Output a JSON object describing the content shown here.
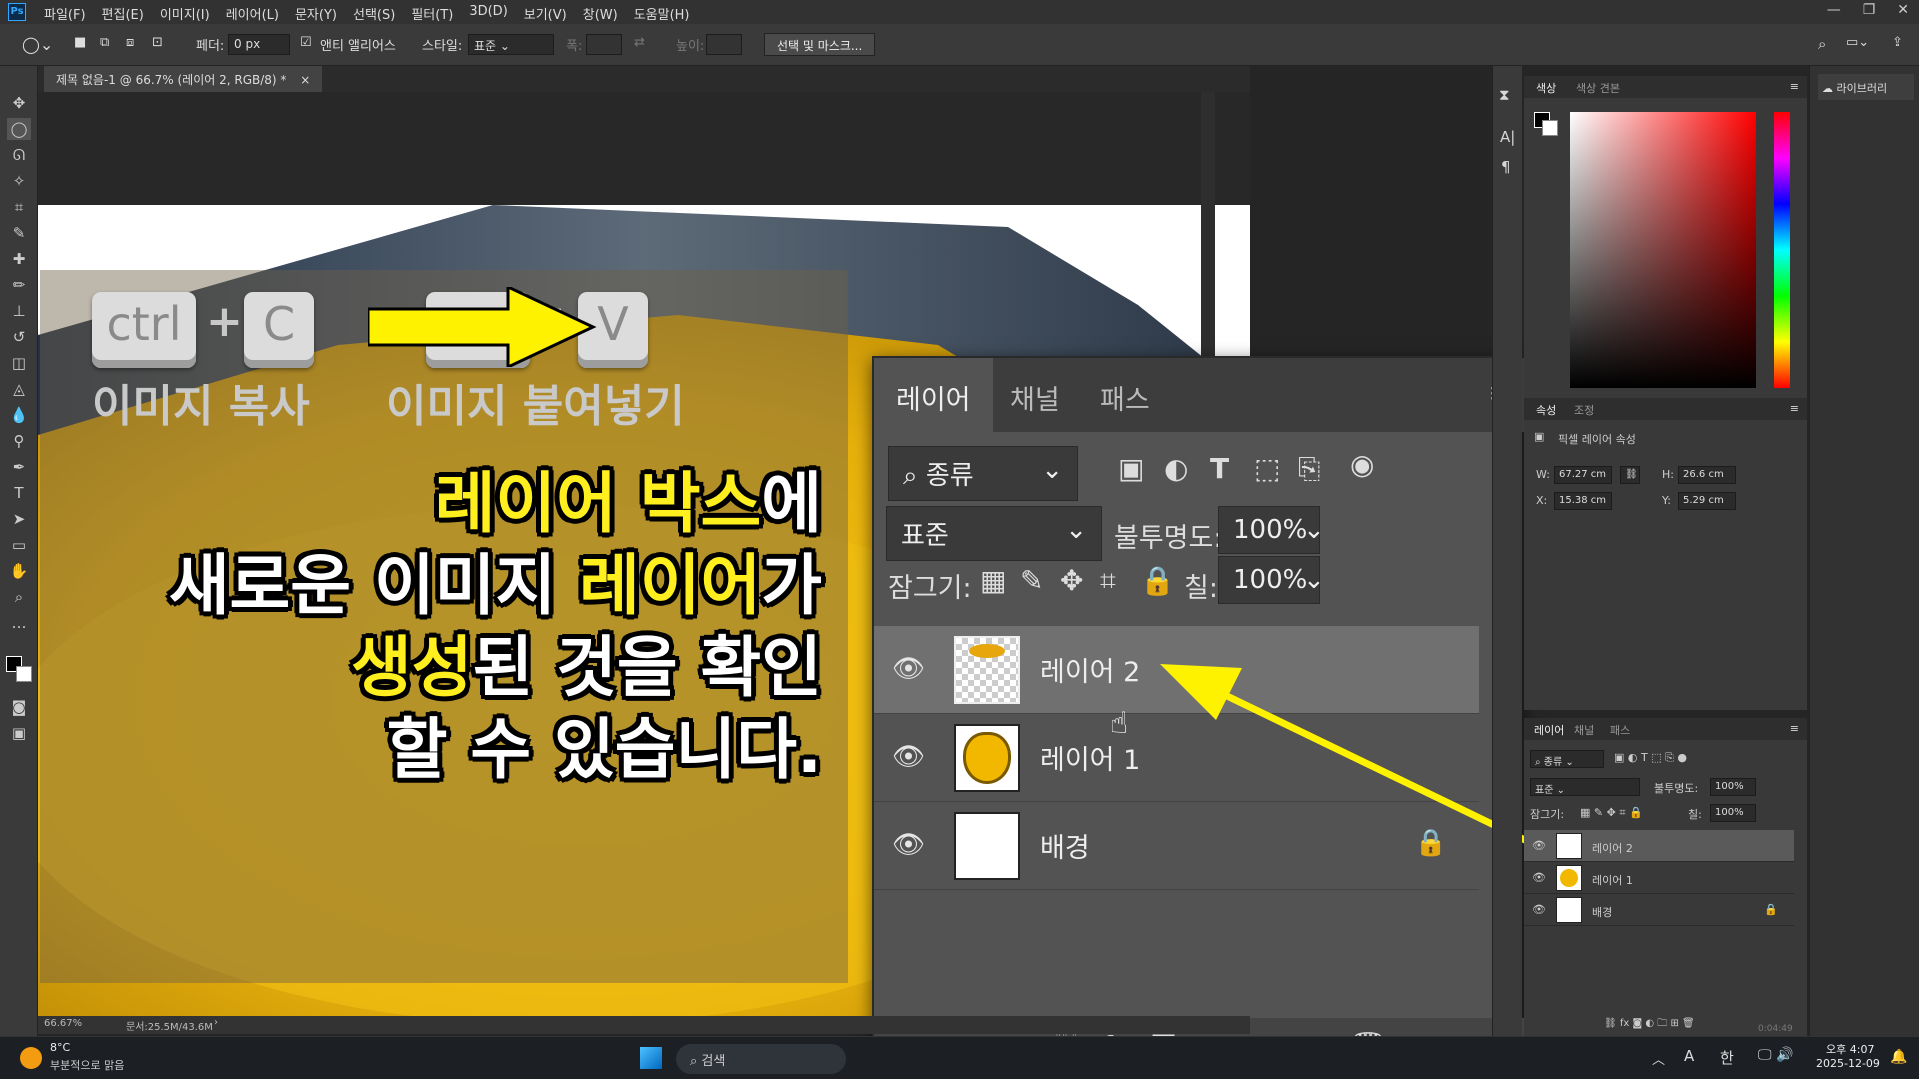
{
  "app": {
    "menu": [
      "파일(F)",
      "편집(E)",
      "이미지(I)",
      "레이어(L)",
      "문자(Y)",
      "선택(S)",
      "필터(T)",
      "3D(D)",
      "보기(V)",
      "창(W)",
      "도움말(H)"
    ],
    "logo": "Ps"
  },
  "options": {
    "feather_label": "페더:",
    "feather_value": "0 px",
    "antialias_label": "앤티 앨리어스",
    "style_label": "스타일:",
    "style_value": "표준",
    "width_label": "폭:",
    "height_label": "높이:",
    "select_mask_button": "선택 및 마스크..."
  },
  "document": {
    "tab_title": "제목 없음-1 @ 66.7% (레이어 2, RGB/8) *",
    "zoom": "66.67%",
    "doc_size": "문서:25.5M/43.6M"
  },
  "overlay": {
    "key_ctrl": "ctrl",
    "key_c": "C",
    "key_v": "V",
    "plus": "+",
    "copy_label": "이미지 복사",
    "paste_label": "이미지 붙여넣기",
    "line1_a": "레이어 박스",
    "line1_b": "에",
    "line2_a": "새로운 이미지 ",
    "line2_b": "레이어",
    "line2_c": "가",
    "line3_a": "생성",
    "line3_b": "된 것을 확인",
    "line4": "할 수 있습니다."
  },
  "big_layers_panel": {
    "tabs": [
      "레이어",
      "채널",
      "패스"
    ],
    "filter_kind": "종류",
    "blend_mode": "표준",
    "opacity_label": "불투명도:",
    "opacity_value": "100%",
    "lock_label": "잠그기:",
    "fill_label": "칠:",
    "fill_value": "100%",
    "layers": [
      {
        "name": "레이어 2",
        "selected": true,
        "thumb": "transparent-with-orange"
      },
      {
        "name": "레이어 1",
        "selected": false,
        "thumb": "orange-cup"
      },
      {
        "name": "배경",
        "selected": false,
        "thumb": "white",
        "locked": true
      }
    ]
  },
  "color_panel": {
    "tabs": [
      "색상",
      "색상 견본"
    ]
  },
  "properties_panel": {
    "tabs": [
      "속성",
      "조정"
    ],
    "title": "픽셀 레이어 속성",
    "w_label": "W:",
    "w_value": "67.27 cm",
    "h_label": "H:",
    "h_value": "26.6 cm",
    "x_label": "X:",
    "x_value": "15.38 cm",
    "y_label": "Y:",
    "y_value": "5.29 cm"
  },
  "small_layers_panel": {
    "tabs": [
      "레이어",
      "채널",
      "패스"
    ],
    "filter_kind": "종류",
    "blend_mode": "표준",
    "opacity_label": "불투명도:",
    "opacity_value": "100%",
    "lock_label": "잠그기:",
    "fill_label": "칠:",
    "fill_value": "100%",
    "layers": [
      "레이어 2",
      "레이어 1",
      "배경"
    ],
    "timer": "0:04:49"
  },
  "library": {
    "label": "라이브러리"
  },
  "taskbar": {
    "weather_temp": "8°C",
    "weather_desc": "부분적으로 맑음",
    "search": "검색",
    "ime_a": "A",
    "ime_han": "한",
    "time": "오후 4:07",
    "date": "2025-12-09"
  },
  "colors": {
    "highlight_yellow": "#ffef1e",
    "arrow_yellow": "#fff200",
    "ps_blue": "#31a8ff"
  }
}
